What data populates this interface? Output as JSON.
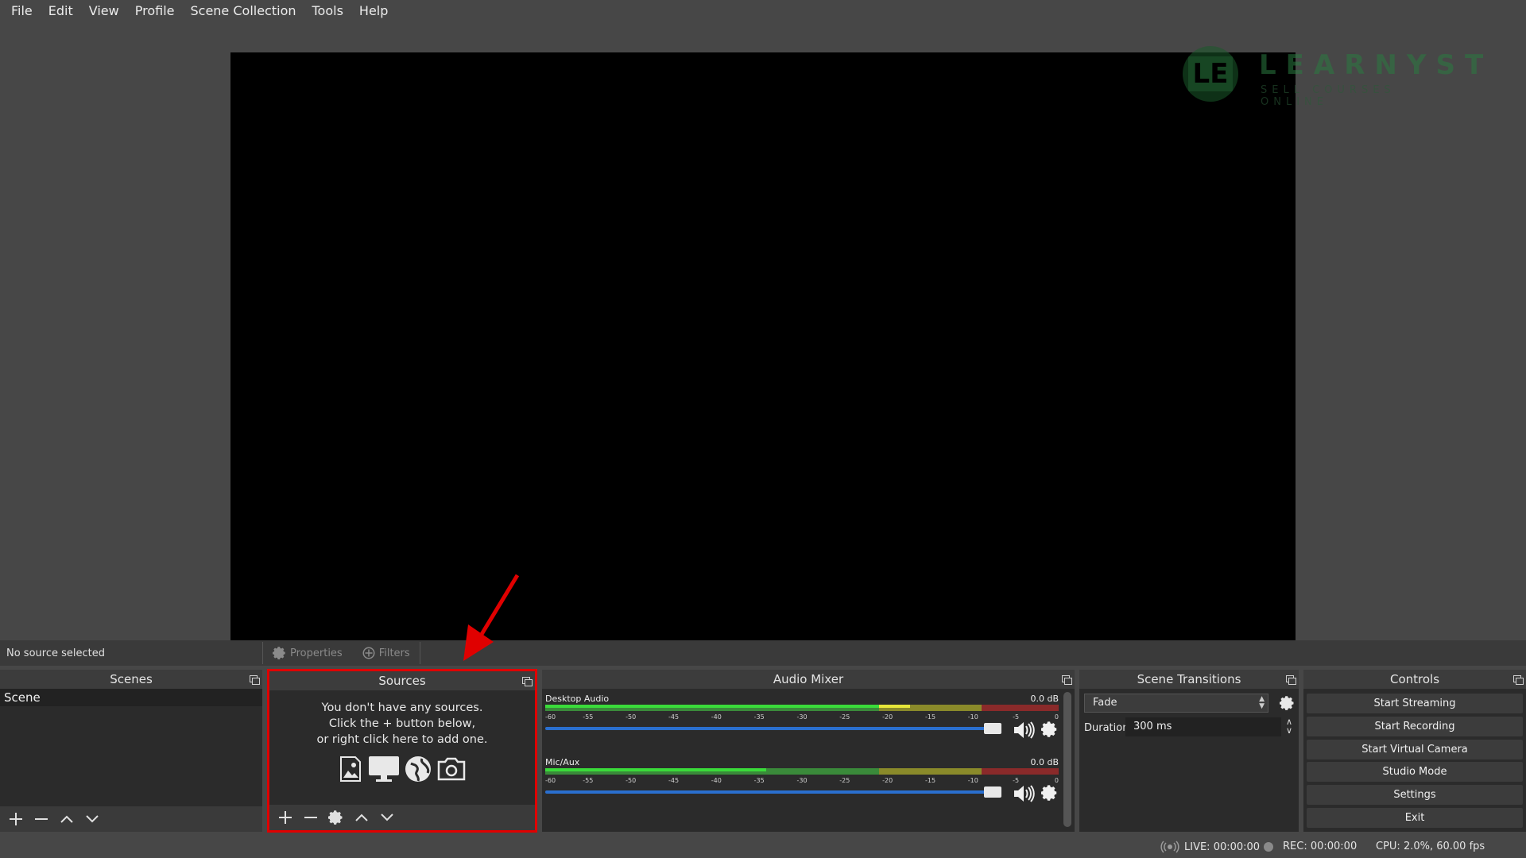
{
  "menu": [
    "File",
    "Edit",
    "View",
    "Profile",
    "Scene Collection",
    "Tools",
    "Help"
  ],
  "watermark": {
    "brand": "LEARNYST",
    "tagline": "SELL COURSES ONLINE",
    "logo_letters": "LE"
  },
  "source_toolbar": {
    "status": "No source selected",
    "properties_label": "Properties",
    "filters_label": "Filters"
  },
  "docks": {
    "scenes": {
      "title": "Scenes",
      "items": [
        "Scene"
      ]
    },
    "sources": {
      "title": "Sources",
      "empty_line1": "You don't have any sources.",
      "empty_line2": "Click the + button below,",
      "empty_line3": "or right click here to add one."
    },
    "mixer": {
      "title": "Audio Mixer",
      "channels": [
        {
          "name": "Desktop Audio",
          "db": "0.0 dB",
          "volume": 1.0
        },
        {
          "name": "Mic/Aux",
          "db": "0.0 dB",
          "volume": 1.0
        }
      ],
      "ticks": [
        "-60",
        "-55",
        "-50",
        "-45",
        "-40",
        "-35",
        "-30",
        "-25",
        "-20",
        "-15",
        "-10",
        "-5",
        "0"
      ]
    },
    "transitions": {
      "title": "Scene Transitions",
      "selected": "Fade",
      "duration_label": "Duration",
      "duration_value": "300 ms"
    },
    "controls": {
      "title": "Controls",
      "buttons": [
        "Start Streaming",
        "Start Recording",
        "Start Virtual Camera",
        "Studio Mode",
        "Settings",
        "Exit"
      ]
    }
  },
  "status": {
    "live": "LIVE: 00:00:00",
    "rec": "REC: 00:00:00",
    "cpu": "CPU: 2.0%, 60.00 fps"
  },
  "colors": {
    "annotation": "#e00000",
    "meter_green": "#3adb3a",
    "slider": "#2a6fcf"
  }
}
